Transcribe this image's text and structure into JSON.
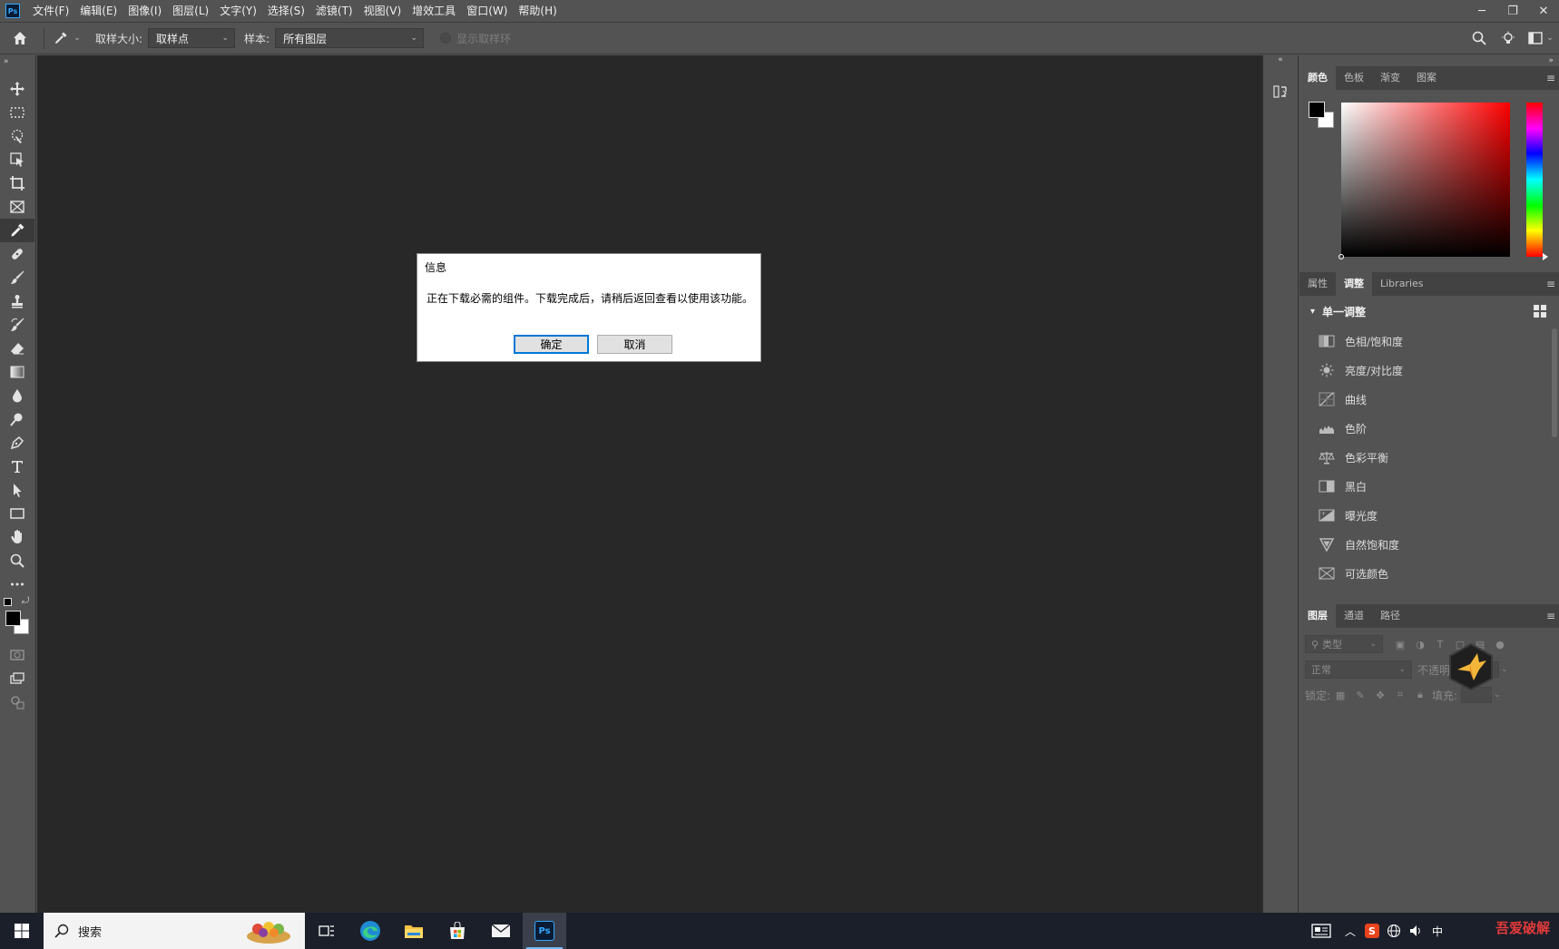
{
  "app": {
    "logo_text": "Ps",
    "accent": "#31a8ff"
  },
  "menu": {
    "items": [
      "文件(F)",
      "编辑(E)",
      "图像(I)",
      "图层(L)",
      "文字(Y)",
      "选择(S)",
      "滤镜(T)",
      "视图(V)",
      "增效工具",
      "窗口(W)",
      "帮助(H)"
    ]
  },
  "window_controls": {
    "minimize": "─",
    "restore": "❐",
    "close": "✕"
  },
  "options": {
    "sample_size_label": "取样大小:",
    "sample_size_value": "取样点",
    "sample_label": "样本:",
    "sample_value": "所有图层",
    "show_ring_label": "显示取样环"
  },
  "toolbar": {
    "collapse": "»",
    "tools": [
      {
        "name": "move-tool",
        "icon": "move-icon"
      },
      {
        "name": "marquee-tool",
        "icon": "marquee-icon"
      },
      {
        "name": "quick-selection-tool",
        "icon": "quick-selection-icon"
      },
      {
        "name": "object-selection-tool",
        "icon": "object-selection-icon"
      },
      {
        "name": "crop-tool",
        "icon": "crop-icon"
      },
      {
        "name": "frame-tool",
        "icon": "frame-icon"
      },
      {
        "name": "eyedropper-tool",
        "icon": "eyedropper-icon",
        "active": true
      },
      {
        "name": "healing-brush-tool",
        "icon": "healing-icon"
      },
      {
        "name": "brush-tool",
        "icon": "brush-icon"
      },
      {
        "name": "clone-stamp-tool",
        "icon": "stamp-icon"
      },
      {
        "name": "history-brush-tool",
        "icon": "history-brush-icon"
      },
      {
        "name": "eraser-tool",
        "icon": "eraser-icon"
      },
      {
        "name": "gradient-tool",
        "icon": "gradient-icon"
      },
      {
        "name": "blur-tool",
        "icon": "blur-icon"
      },
      {
        "name": "dodge-tool",
        "icon": "dodge-icon"
      },
      {
        "name": "pen-tool",
        "icon": "pen-icon"
      },
      {
        "name": "type-tool",
        "icon": "type-icon"
      },
      {
        "name": "path-selection-tool",
        "icon": "path-selection-icon"
      },
      {
        "name": "rectangle-tool",
        "icon": "rectangle-icon"
      },
      {
        "name": "hand-tool",
        "icon": "hand-icon"
      },
      {
        "name": "zoom-tool",
        "icon": "zoom-icon"
      },
      {
        "name": "more-tools",
        "icon": "more-icon"
      }
    ]
  },
  "dialog": {
    "title": "信息",
    "message": "正在下载必需的组件。下载完成后，请稍后返回查看以使用该功能。",
    "ok_label": "确定",
    "cancel_label": "取消"
  },
  "color_panel": {
    "tabs": [
      "颜色",
      "色板",
      "渐变",
      "图案"
    ],
    "active_tab": 0,
    "foreground": "#000000",
    "background": "#ffffff"
  },
  "adjust_panel": {
    "tabs": [
      "属性",
      "调整",
      "Libraries"
    ],
    "active_tab": 1,
    "section_title": "单一调整",
    "items": [
      {
        "label": "色相/饱和度",
        "icon": "hue-saturation-icon"
      },
      {
        "label": "亮度/对比度",
        "icon": "brightness-contrast-icon"
      },
      {
        "label": "曲线",
        "icon": "curves-icon"
      },
      {
        "label": "色阶",
        "icon": "levels-icon"
      },
      {
        "label": "色彩平衡",
        "icon": "color-balance-icon"
      },
      {
        "label": "黑白",
        "icon": "black-white-icon"
      },
      {
        "label": "曝光度",
        "icon": "exposure-icon"
      },
      {
        "label": "自然饱和度",
        "icon": "vibrance-icon"
      },
      {
        "label": "可选颜色",
        "icon": "selective-color-icon"
      }
    ]
  },
  "layers_panel": {
    "tabs": [
      "图层",
      "通道",
      "路径"
    ],
    "active_tab": 0,
    "filter_placeholder": "类型",
    "blend_mode": "正常",
    "opacity_label": "不透明度:",
    "lock_label": "锁定:",
    "fill_label": "填充:"
  },
  "taskbar": {
    "search_text": "搜索",
    "tray_lang": "中",
    "watermark": "吾爱破解"
  }
}
